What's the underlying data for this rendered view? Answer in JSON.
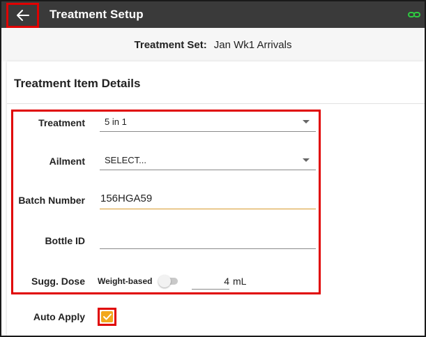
{
  "app_bar": {
    "title": "Treatment Setup",
    "icons": {
      "back": "arrow-left-icon",
      "link": "link-icon"
    },
    "colors": {
      "background": "#3a3a3a",
      "link_icon": "#2ecc40",
      "highlight": "#e00000"
    }
  },
  "treatment_set": {
    "label": "Treatment Set:",
    "value": "Jan Wk1 Arrivals"
  },
  "card": {
    "title": "Treatment Item Details"
  },
  "form": {
    "treatment": {
      "label": "Treatment",
      "value": "5 in 1"
    },
    "ailment": {
      "label": "Ailment",
      "value": "SELECT..."
    },
    "batch_number": {
      "label": "Batch Number",
      "value": "156HGA59"
    },
    "bottle_id": {
      "label": "Bottle ID",
      "value": ""
    },
    "sugg_dose": {
      "label": "Sugg. Dose",
      "weight_based_label": "Weight-based",
      "weight_based_enabled": false,
      "value": "4",
      "unit": "mL"
    },
    "auto_apply": {
      "label": "Auto Apply",
      "checked": true
    }
  },
  "colors": {
    "accent": "#f2a81d",
    "active_underline": "#d89a2b"
  }
}
